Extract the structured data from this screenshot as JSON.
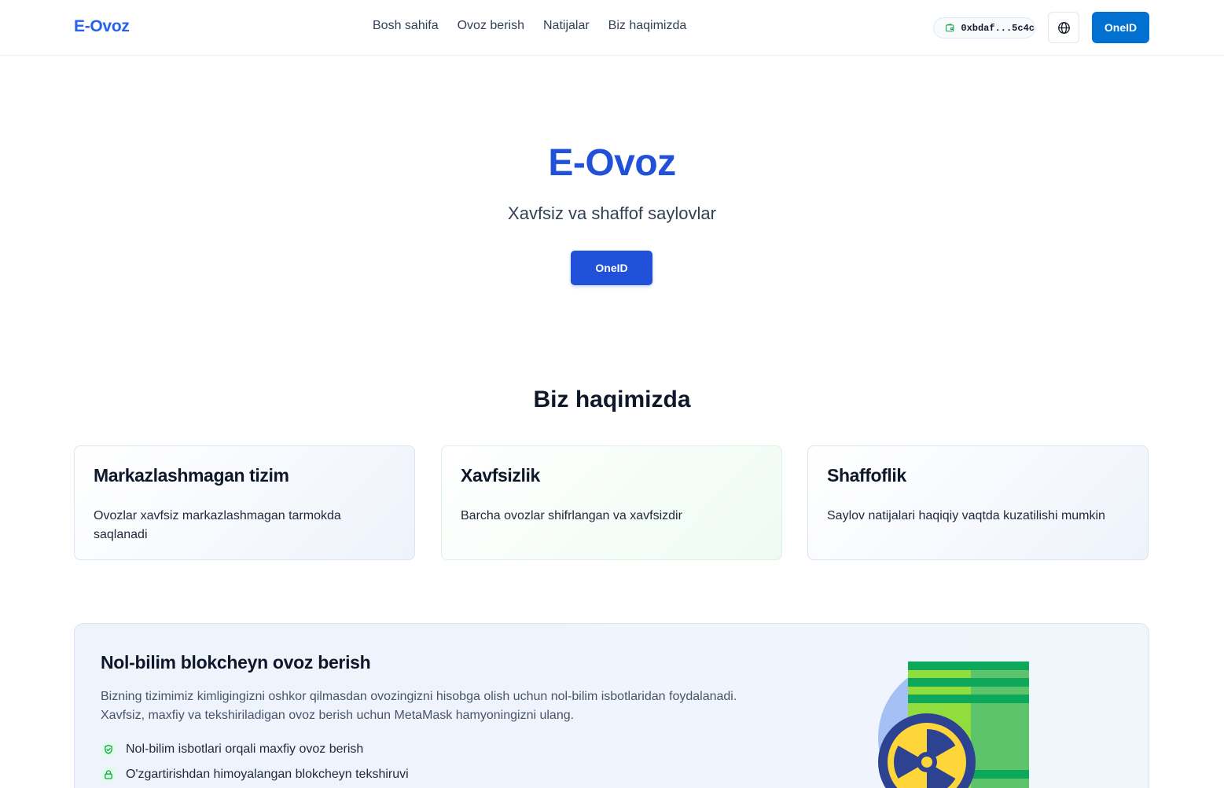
{
  "header": {
    "logo": "E-Ovoz",
    "nav": [
      "Bosh sahifa",
      "Ovoz berish",
      "Natijalar",
      "Biz haqimizda"
    ],
    "wallet_address": "0xbdaf...5c4c",
    "language_icon": "globe-icon",
    "login_label": "OneID"
  },
  "hero": {
    "title": "E-Ovoz",
    "subtitle": "Xavfsiz va shaffof saylovlar",
    "button_label": "OneID"
  },
  "about": {
    "title": "Biz haqimizda",
    "cards": [
      {
        "title": "Markazlashmagan tizim",
        "text": "Ovozlar xavfsiz markazlashmagan tarmokda saqlanadi"
      },
      {
        "title": "Xavfsizlik",
        "text": "Barcha ovozlar shifrlangan va xavfsizdir"
      },
      {
        "title": "Shaffoflik",
        "text": "Saylov natijalari haqiqiy vaqtda kuzatilishi mumkin"
      }
    ]
  },
  "zk": {
    "title": "Nol-bilim blokcheyn ovoz berish",
    "description": "Bizning tizimimiz kimligingizni oshkor qilmasdan ovozingizni hisobga olish uchun nol-bilim isbotlaridan foydalanadi. Xavfsiz, maxfiy va tekshiriladigan ovoz berish uchun MetaMask hamyoningizni ulang.",
    "features": [
      {
        "icon": "shield-check-icon",
        "text": "Nol-bilim isbotlari orqali maxfiy ovoz berish"
      },
      {
        "icon": "lock-icon",
        "text": "O'zgartirishdan himoyalangan blokcheyn tekshiruvi"
      }
    ]
  },
  "colors": {
    "brand": "#2563eb",
    "primary_button": "#0070d1",
    "hero_button": "#2151d8",
    "success": "#16a34a"
  }
}
